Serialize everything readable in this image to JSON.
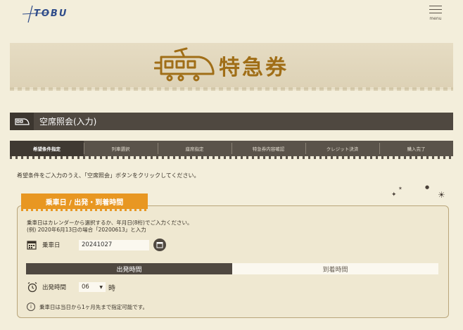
{
  "header": {
    "logo": "TOBU",
    "menu_label": "menu"
  },
  "banner": {
    "title": "特急券"
  },
  "section": {
    "title": "空席照会(入力)"
  },
  "steps": [
    {
      "label": "希望条件指定"
    },
    {
      "label": "列車選択"
    },
    {
      "label": "座席指定"
    },
    {
      "label": "特急券内容確認"
    },
    {
      "label": "クレジット決済"
    },
    {
      "label": "購入完了"
    }
  ],
  "instruction": "希望条件をご入力のうえ、「空席照会」ボタンをクリックしてください。",
  "panel": {
    "tab": "乗車日 / 出発・到着時間",
    "help_line1": "乗車日はカレンダーから選択するか、年月日(8桁)でご入力ください。",
    "help_line2": "(例) 2020年6月13日の場合「20200613」と入力",
    "date_label": "乗車日",
    "date_value": "20241027",
    "toggle_departure": "出発時間",
    "toggle_arrival": "到着時間",
    "time_label": "出発時間",
    "time_value": "06",
    "time_unit": "時",
    "note": "乗車日は当日から1ヶ月先まで指定可能です。"
  },
  "colors": {
    "accent": "#e89722",
    "dark": "#4f4840",
    "gold": "#a06e17"
  }
}
